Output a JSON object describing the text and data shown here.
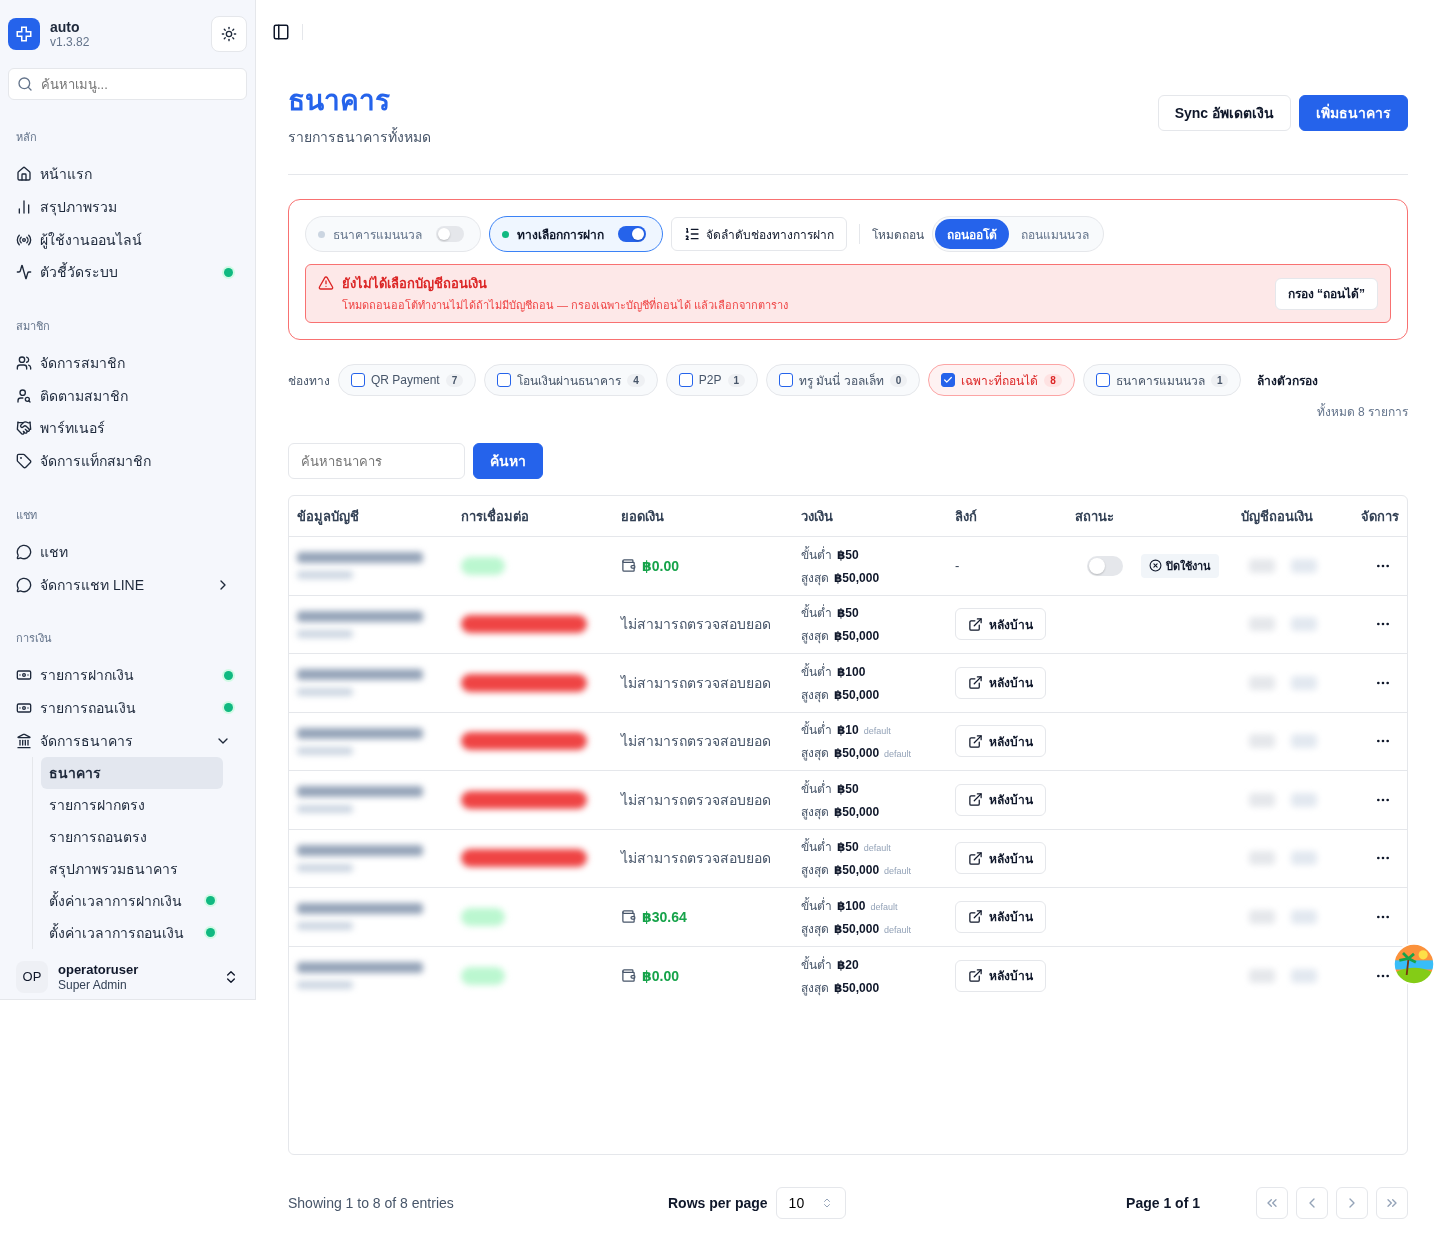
{
  "sidebar": {
    "app": {
      "name": "auto",
      "version": "v1.3.82"
    },
    "search": {
      "placeholder": "ค้นหาเมนู..."
    },
    "sections": [
      {
        "title": "หลัก",
        "items": [
          {
            "label": "หน้าแรก",
            "dot": false
          },
          {
            "label": "สรุปภาพรวม",
            "dot": false
          },
          {
            "label": "ผู้ใช้งานออนไลน์",
            "dot": false
          },
          {
            "label": "ตัวชี้วัดระบบ",
            "dot": true
          }
        ]
      },
      {
        "title": "สมาชิก",
        "items": [
          {
            "label": "จัดการสมาชิก",
            "dot": false
          },
          {
            "label": "ติดตามสมาชิก",
            "dot": false
          },
          {
            "label": "พาร์ทเนอร์",
            "dot": false
          },
          {
            "label": "จัดการแท็กสมาชิก",
            "dot": false
          }
        ]
      },
      {
        "title": "แชท",
        "items": [
          {
            "label": "แชท",
            "dot": false
          },
          {
            "label": "จัดการแชท LINE",
            "dot": false,
            "expanded": false
          }
        ]
      },
      {
        "title": "การเงิน",
        "items": [
          {
            "label": "รายการฝากเงิน",
            "dot": true
          },
          {
            "label": "รายการถอนเงิน",
            "dot": true
          },
          {
            "label": "จัดการธนาคาร",
            "dot": false,
            "expanded": true,
            "children": [
              {
                "label": "ธนาคาร",
                "selected": true,
                "dot": false
              },
              {
                "label": "รายการฝากตรง",
                "selected": false,
                "dot": false
              },
              {
                "label": "รายการถอนตรง",
                "selected": false,
                "dot": false
              },
              {
                "label": "สรุปภาพรวมธนาคาร",
                "selected": false,
                "dot": false
              },
              {
                "label": "ตั้งค่าเวลาการฝากเงิน",
                "selected": false,
                "dot": true
              },
              {
                "label": "ตั้งค่าเวลาการถอนเงิน",
                "selected": false,
                "dot": true
              }
            ]
          }
        ]
      }
    ],
    "user": {
      "initials": "OP",
      "name": "operatoruser",
      "role": "Super Admin"
    }
  },
  "header": {
    "title": "ธนาคาร",
    "subtitle": "รายการธนาคารทั้งหมด",
    "buttons": [
      {
        "label": "Sync อัพเดตเงิน",
        "kind": "secondary"
      },
      {
        "label": "เพิ่มธนาคาร",
        "kind": "primary"
      }
    ]
  },
  "controls": {
    "toggles": [
      {
        "label": "ธนาคารแมนนวล",
        "on": false
      },
      {
        "label": "ทางเลือกการฝาก",
        "on": true
      }
    ],
    "order_button": "จัดลำดับช่องทางการฝาก",
    "mode": {
      "label": "โหมดถอน",
      "options": [
        {
          "label": "ถอนออโต้",
          "selected": true
        },
        {
          "label": "ถอนแมนนวล",
          "selected": false
        }
      ]
    },
    "alert": {
      "title": "ยังไม่ได้เลือกบัญชีถอนเงิน",
      "message": "โหมดถอนออโต้ทำงานไม่ได้ถ้าไม่มีบัญชีถอน — กรองเฉพาะบัญชีที่ถอนได้ แล้วเลือกจากตาราง",
      "button": "กรอง “ถอนได้”"
    }
  },
  "filters": {
    "label": "ช่องทาง",
    "chips": [
      {
        "label": "QR Payment",
        "count": "7",
        "checked": false
      },
      {
        "label": "โอนเงินผ่านธนาคาร",
        "count": "4",
        "checked": false
      },
      {
        "label": "P2P",
        "count": "1",
        "checked": false
      },
      {
        "label": "ทรู มันนี่ วอลเล็ท",
        "count": "0",
        "checked": false
      },
      {
        "label": "เฉพาะที่ถอนได้",
        "count": "8",
        "checked": true
      },
      {
        "label": "ธนาคารแมนนวล",
        "count": "1",
        "checked": false
      }
    ],
    "clear": "ล้างตัวกรอง",
    "total": "ทั้งหมด 8 รายการ"
  },
  "search": {
    "placeholder": "ค้นหาธนาคาร",
    "button": "ค้นหา"
  },
  "table": {
    "columns": [
      "ข้อมูลบัญชี",
      "การเชื่อมต่อ",
      "ยอดเงิน",
      "วงเงิน",
      "ลิงก์",
      "สถานะ",
      "บัญชีถอนเงิน",
      "จัดการ"
    ],
    "rows": [
      {
        "connected": true,
        "balance": {
          "kind": "amount",
          "text": "฿0.00"
        },
        "min": {
          "label": "ขั้นต่ำ",
          "value": "฿50"
        },
        "max": {
          "label": "สูงสุด",
          "value": "฿50,000"
        },
        "link": {
          "kind": "none",
          "text": "-"
        },
        "status": {
          "on": false,
          "label": "ปิดใช้งาน"
        }
      },
      {
        "connected": false,
        "balance": {
          "kind": "error",
          "text": "ไม่สามารถตรวจสอบยอด"
        },
        "min": {
          "label": "ขั้นต่ำ",
          "value": "฿50"
        },
        "max": {
          "label": "สูงสุด",
          "value": "฿50,000"
        },
        "link": {
          "kind": "button",
          "text": "หลังบ้าน"
        }
      },
      {
        "connected": false,
        "balance": {
          "kind": "error",
          "text": "ไม่สามารถตรวจสอบยอด"
        },
        "min": {
          "label": "ขั้นต่ำ",
          "value": "฿100"
        },
        "max": {
          "label": "สูงสุด",
          "value": "฿50,000"
        },
        "link": {
          "kind": "button",
          "text": "หลังบ้าน"
        }
      },
      {
        "connected": false,
        "balance": {
          "kind": "error",
          "text": "ไม่สามารถตรวจสอบยอด"
        },
        "min": {
          "label": "ขั้นต่ำ",
          "value": "฿10",
          "note": "default"
        },
        "max": {
          "label": "สูงสุด",
          "value": "฿50,000",
          "note": "default"
        },
        "link": {
          "kind": "button",
          "text": "หลังบ้าน"
        }
      },
      {
        "connected": false,
        "balance": {
          "kind": "error",
          "text": "ไม่สามารถตรวจสอบยอด"
        },
        "min": {
          "label": "ขั้นต่ำ",
          "value": "฿50"
        },
        "max": {
          "label": "สูงสุด",
          "value": "฿50,000"
        },
        "link": {
          "kind": "button",
          "text": "หลังบ้าน"
        }
      },
      {
        "connected": false,
        "balance": {
          "kind": "error",
          "text": "ไม่สามารถตรวจสอบยอด"
        },
        "min": {
          "label": "ขั้นต่ำ",
          "value": "฿50",
          "note": "default"
        },
        "max": {
          "label": "สูงสุด",
          "value": "฿50,000",
          "note": "default"
        },
        "link": {
          "kind": "button",
          "text": "หลังบ้าน"
        }
      },
      {
        "connected": true,
        "balance": {
          "kind": "amount",
          "text": "฿30.64"
        },
        "min": {
          "label": "ขั้นต่ำ",
          "value": "฿100",
          "note": "default"
        },
        "max": {
          "label": "สูงสุด",
          "value": "฿50,000",
          "note": "default"
        },
        "link": {
          "kind": "button",
          "text": "หลังบ้าน"
        }
      },
      {
        "connected": true,
        "balance": {
          "kind": "amount",
          "text": "฿0.00"
        },
        "min": {
          "label": "ขั้นต่ำ",
          "value": "฿20"
        },
        "max": {
          "label": "สูงสุด",
          "value": "฿50,000"
        },
        "link": {
          "kind": "button",
          "text": "หลังบ้าน"
        }
      }
    ]
  },
  "pagination": {
    "showing": "Showing 1 to 8 of 8 entries",
    "rows_label": "Rows per page",
    "rows_value": "10",
    "page": "Page 1 of 1"
  }
}
